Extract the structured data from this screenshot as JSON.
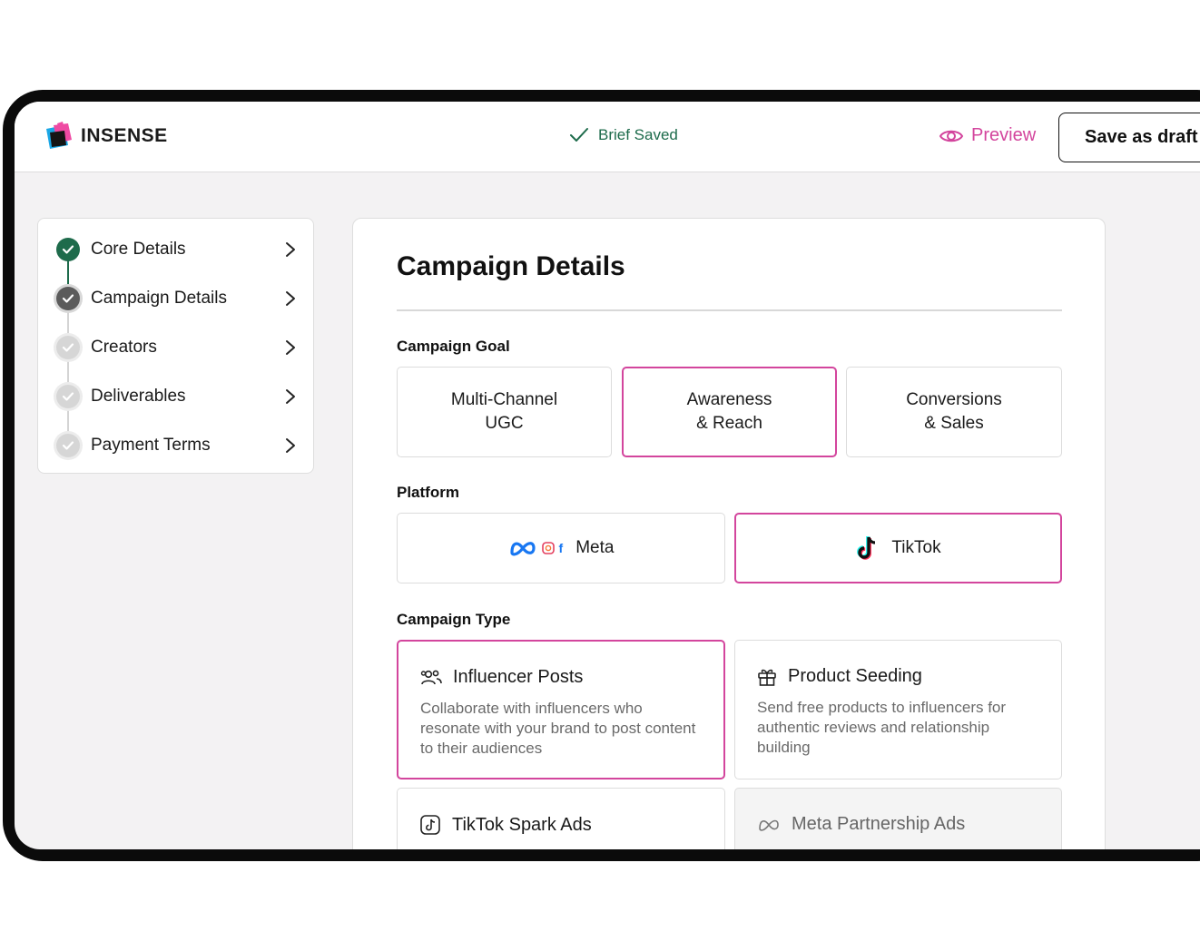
{
  "brand": {
    "name": "INSENSE"
  },
  "header": {
    "status_text": "Brief Saved",
    "preview_label": "Preview",
    "save_draft_label": "Save as draft"
  },
  "steps": [
    {
      "label": "Core Details",
      "state": "done"
    },
    {
      "label": "Campaign Details",
      "state": "current"
    },
    {
      "label": "Creators",
      "state": "todo"
    },
    {
      "label": "Deliverables",
      "state": "todo"
    },
    {
      "label": "Payment Terms",
      "state": "todo"
    }
  ],
  "main": {
    "title": "Campaign Details",
    "goal": {
      "label": "Campaign Goal",
      "options": [
        {
          "label": "Multi-Channel\nUGC",
          "selected": false
        },
        {
          "label": "Awareness\n& Reach",
          "selected": true
        },
        {
          "label": "Conversions\n& Sales",
          "selected": false
        }
      ]
    },
    "platform": {
      "label": "Platform",
      "options": [
        {
          "label": "Meta",
          "selected": false,
          "icon": "meta-icon"
        },
        {
          "label": "TikTok",
          "selected": true,
          "icon": "tiktok-icon"
        }
      ]
    },
    "type": {
      "label": "Campaign Type",
      "options": [
        {
          "title": "Influencer Posts",
          "description": "Collaborate with influencers who resonate with your brand to post content to their audiences",
          "selected": true,
          "icon": "users-icon"
        },
        {
          "title": "Product Seeding",
          "description": "Send free products to influencers for authentic reviews and relationship building",
          "selected": false,
          "icon": "gift-icon"
        },
        {
          "title": "TikTok Spark Ads",
          "description": "",
          "selected": false,
          "icon": "tiktok-square-icon"
        },
        {
          "title": "Meta Partnership Ads",
          "description": "",
          "selected": false,
          "disabled": true,
          "icon": "meta-outline-icon"
        }
      ]
    }
  },
  "colors": {
    "accent": "#d3459d",
    "success": "#1e6b4b",
    "frame": "#0b0b0b",
    "background": "#f3f2f3"
  }
}
